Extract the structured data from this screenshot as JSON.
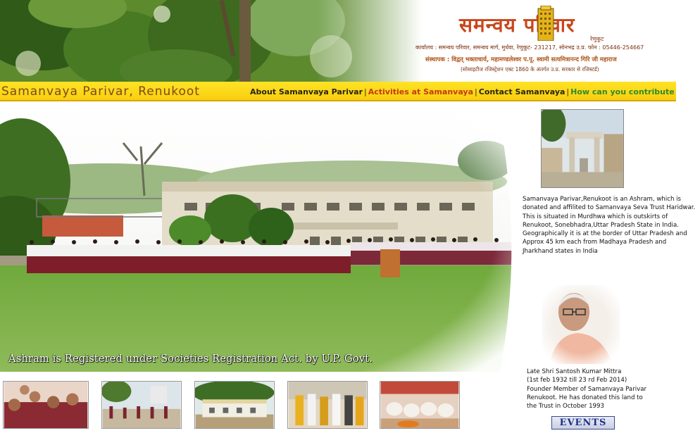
{
  "header": {
    "logo_title": "समन्वय परिवार",
    "logo_subtitle": "रेणुकूट",
    "address_line": "कार्यालय : समन्वय परिवार, समन्वय मार्ग, मुर्धवा, रेणुकूट- 231217, सोनभद्र उ.प्र. फोन : 05446-254667",
    "patron_line": "संस्थापक : विद्वत् भक्ताचार्य, महामण्डलेश्वर प.पू. स्वामी सत्यमित्रानन्द गिरि जी महाराज",
    "registration_line": "(सोसाइटीज रजिस्ट्रेशन एक्ट 1860 के अंतर्गत उ.प्र. सरकार से रजिस्टर्ड)"
  },
  "navbar": {
    "site_title": "Samanvaya Parivar, Renukoot",
    "links": {
      "about": "About Samanvaya Parivar",
      "activities": "Activities at Samanvaya",
      "contact": "Contact Samanvaya",
      "contribute": "How can you contribute"
    },
    "separator": "|"
  },
  "main": {
    "caption": "Ashram is Registered under Societies Registration Act. by U.P. Govt."
  },
  "sidebar": {
    "about_text": "Samanvaya Parivar,Renukoot is an Ashram, which is donated and affilited to Samanvaya Seva Trust Haridwar. This is situated in Murdhwa which is outskirts of Renukoot, Sonebhadra,Uttar Pradesh State in India. Geographically it is at the border of Uttar Pradesh and Approx 45 km each from Madhaya Pradesh and Jharkhand states in India",
    "founder_lines": [
      "Late Shri Santosh Kumar Mittra",
      "(1st feb 1932 till 23 rd Feb 2014)",
      "Founder Member of Samanvaya Parivar",
      "Renukoot. He has donated this land to",
      "the Trust in October 1993"
    ],
    "events_label": "EVENTS"
  },
  "colors": {
    "navbar_yellow": "#f8d21a",
    "logo_orange": "#c8461c",
    "activities_red": "#c43a12",
    "contribute_green": "#2f8a2a",
    "events_blue": "#1d2f86"
  },
  "icons": {
    "logo": "tower-logo-icon"
  }
}
